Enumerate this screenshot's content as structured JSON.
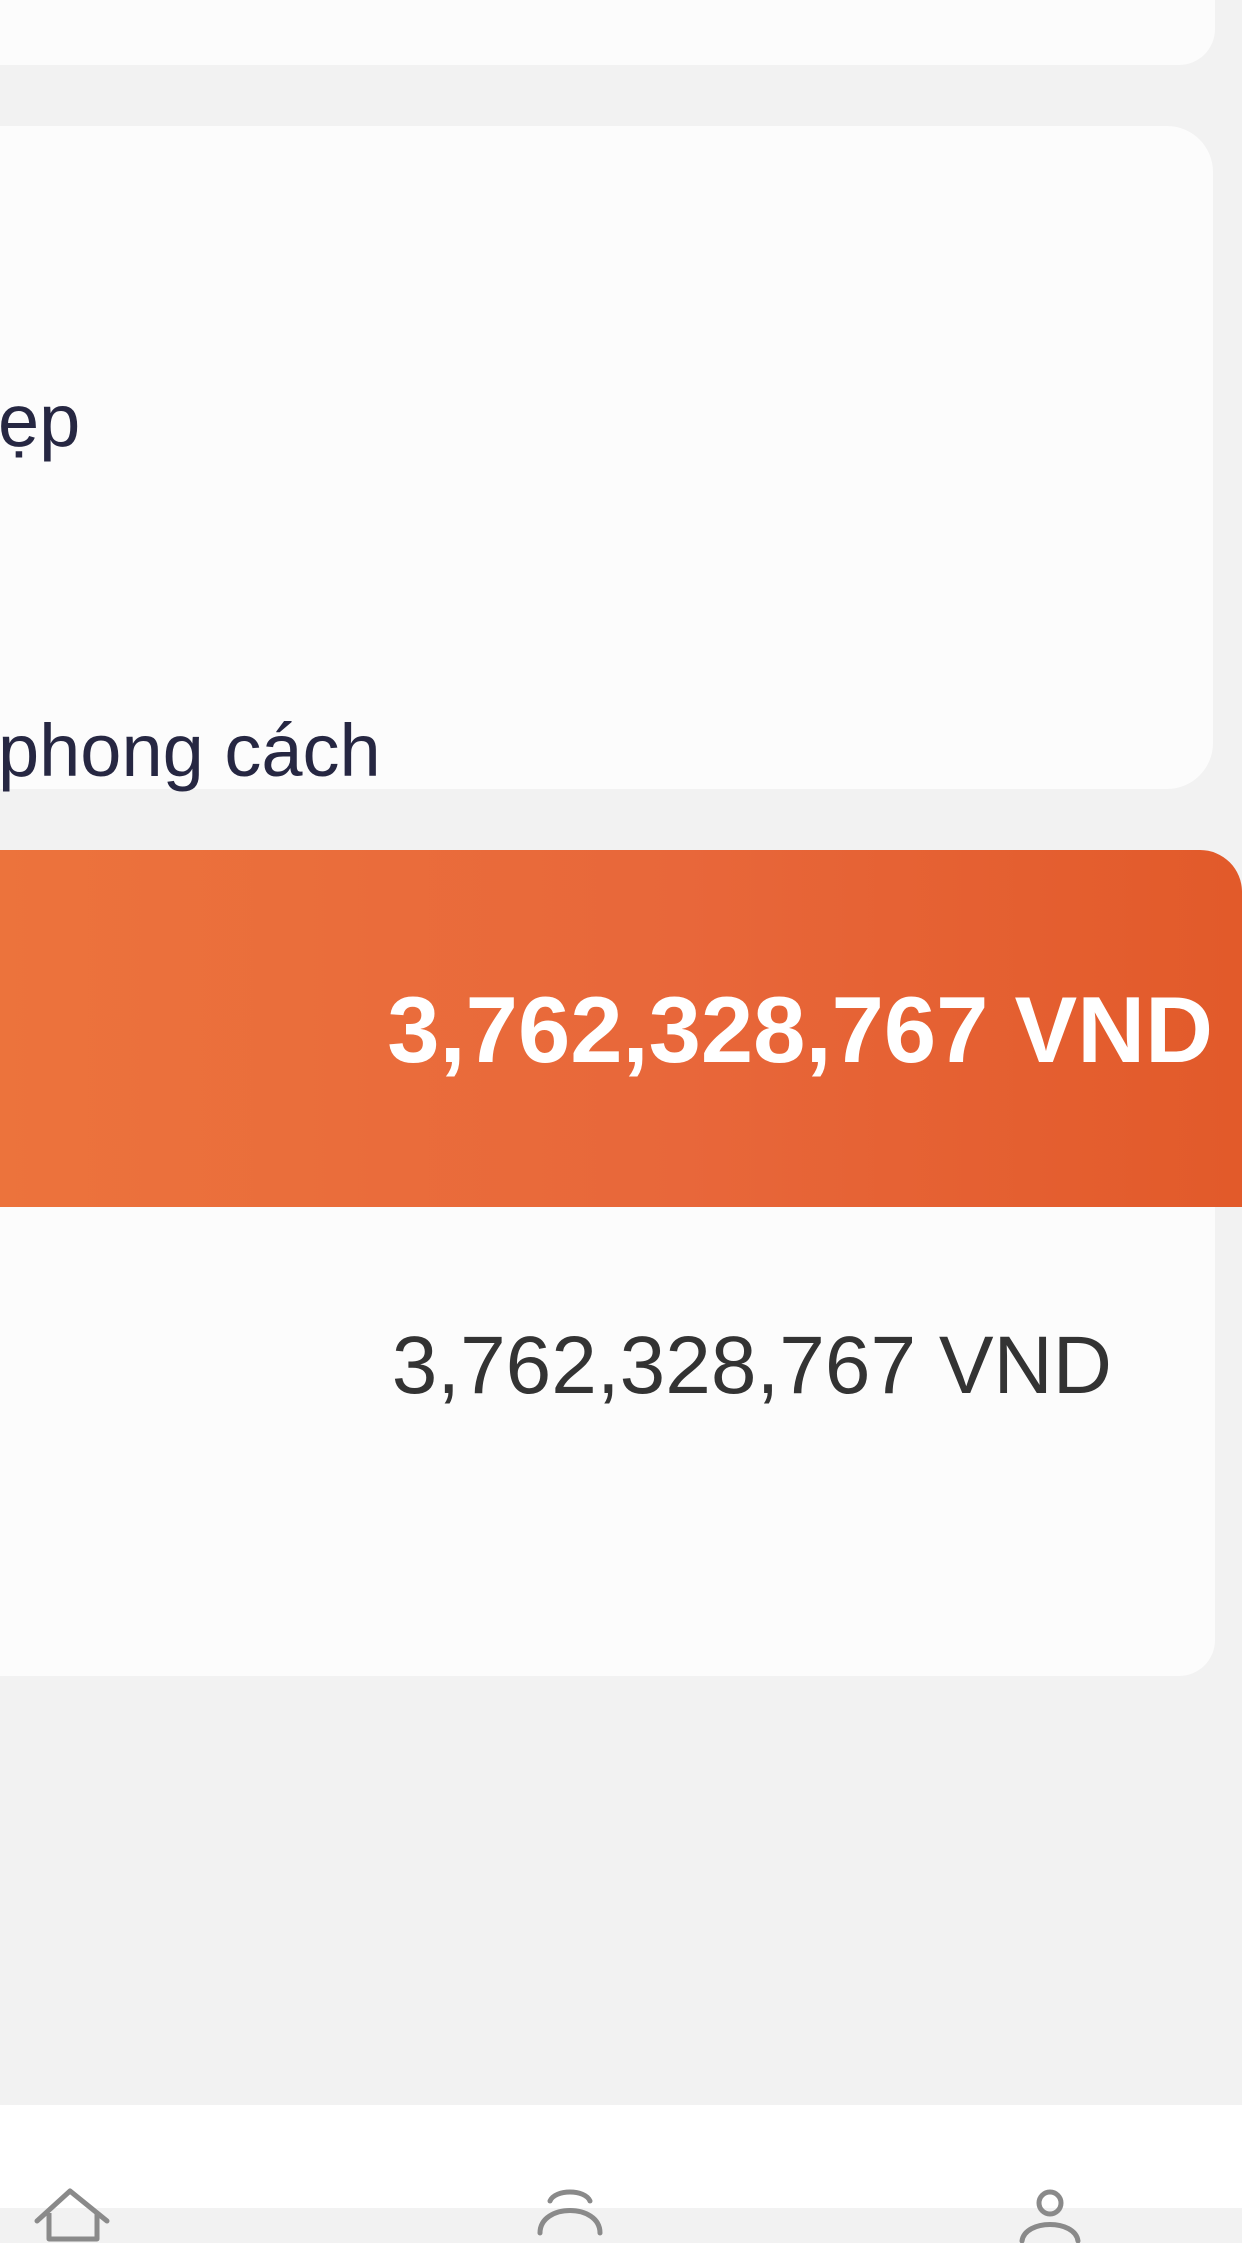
{
  "content_card": {
    "line_1": "ẹp",
    "line_2": "phong cách"
  },
  "total_banner": {
    "amount": "3,762,328,767 VND"
  },
  "amount_card": {
    "amount": "3,762,328,767 VND"
  },
  "bottom_navigation": {
    "items": [
      {
        "icon": "home-icon"
      },
      {
        "icon": "support-icon"
      },
      {
        "icon": "account-icon"
      }
    ]
  },
  "colors": {
    "background": "#f2f2f2",
    "card": "#fcfcfc",
    "accent_orange": "#e8673a",
    "text_dark": "#262742",
    "white": "#ffffff"
  }
}
